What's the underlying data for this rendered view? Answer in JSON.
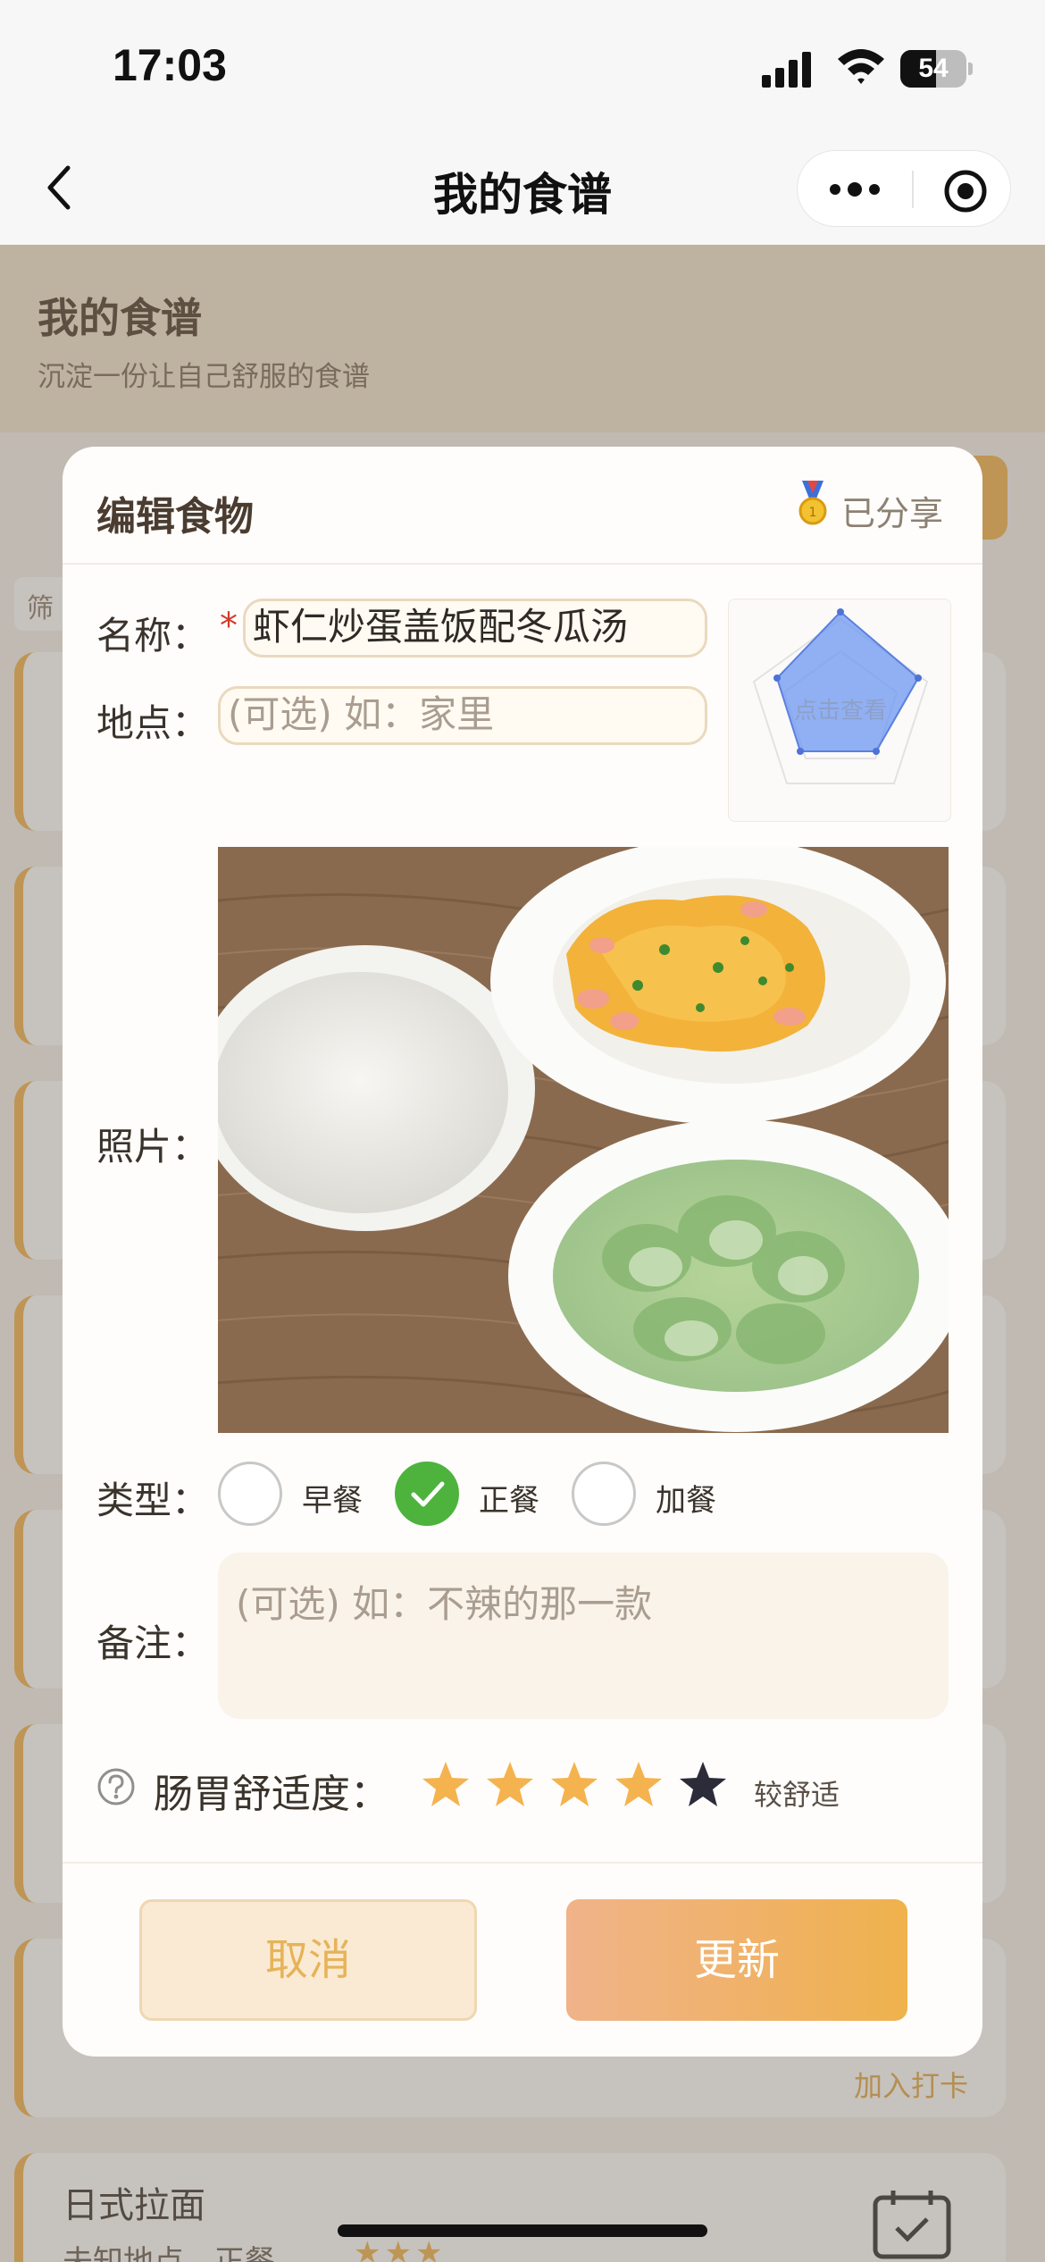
{
  "status_bar": {
    "time": "17:03",
    "battery": "54",
    "battery_level": 0.54
  },
  "nav": {
    "title": "我的食谱"
  },
  "page": {
    "title": "我的食谱",
    "subtitle": "沉淀一份让自己舒服的食谱",
    "filter_label": "筛",
    "last_card": {
      "name": "日式拉面",
      "meta": "未知地点 - 正餐",
      "stars": "★★★"
    },
    "visible_action": "加入打卡"
  },
  "modal": {
    "title": "编辑食物",
    "shared_label": "已分享",
    "name_label": "名称：",
    "required_mark": "*",
    "name_value": "虾仁炒蛋盖饭配冬瓜汤",
    "location_label": "地点：",
    "location_placeholder": "(可选) 如：家里",
    "radar_hint": "点击查看",
    "photo_label": "照片：",
    "type_label": "类型：",
    "type_options": [
      {
        "label": "早餐",
        "checked": false
      },
      {
        "label": "正餐",
        "checked": true
      },
      {
        "label": "加餐",
        "checked": false
      }
    ],
    "note_label": "备注：",
    "note_placeholder": "(可选) 如：不辣的那一款",
    "comfort_label": "肠胃舒适度：",
    "comfort_rating": 4,
    "comfort_max": 5,
    "comfort_text": "较舒适",
    "cancel_label": "取消",
    "update_label": "更新"
  },
  "colors": {
    "accent": "#f1b24a",
    "check": "#4db33d",
    "radar": "#6d95f2",
    "star_on": "#f4b34f",
    "star_off": "#2b2b3a"
  }
}
